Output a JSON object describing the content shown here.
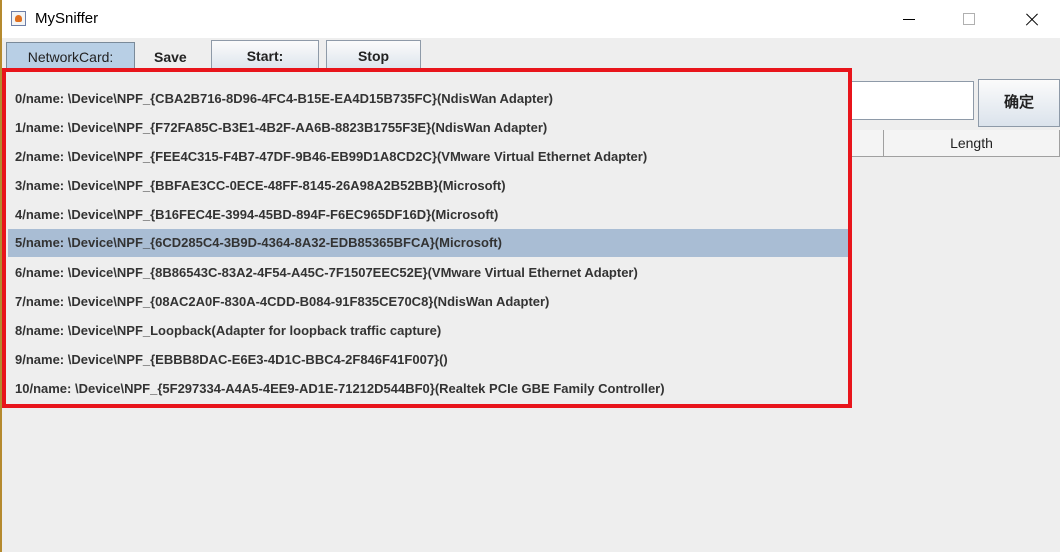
{
  "window": {
    "title": "MySniffer"
  },
  "menubar": {
    "networkcard": "NetworkCard:",
    "save": "Save"
  },
  "toolbar": {
    "start": "Start:",
    "stop": "Stop"
  },
  "filter": {
    "value": "",
    "confirm": "确定"
  },
  "table": {
    "columns": [
      "",
      "Length"
    ]
  },
  "networkcard_menu": {
    "selected_index": 5,
    "items": [
      "0/name: \\Device\\NPF_{CBA2B716-8D96-4FC4-B15E-EA4D15B735FC}(NdisWan Adapter)",
      "1/name: \\Device\\NPF_{F72FA85C-B3E1-4B2F-AA6B-8823B1755F3E}(NdisWan Adapter)",
      "2/name: \\Device\\NPF_{FEE4C315-F4B7-47DF-9B46-EB99D1A8CD2C}(VMware Virtual Ethernet Adapter)",
      "3/name: \\Device\\NPF_{BBFAE3CC-0ECE-48FF-8145-26A98A2B52BB}(Microsoft)",
      "4/name: \\Device\\NPF_{B16FEC4E-3994-45BD-894F-F6EC965DF16D}(Microsoft)",
      "5/name: \\Device\\NPF_{6CD285C4-3B9D-4364-8A32-EDB85365BFCA}(Microsoft)",
      "6/name: \\Device\\NPF_{8B86543C-83A2-4F54-A45C-7F1507EEC52E}(VMware Virtual Ethernet Adapter)",
      "7/name: \\Device\\NPF_{08AC2A0F-830A-4CDD-B084-91F835CE70C8}(NdisWan Adapter)",
      "8/name: \\Device\\NPF_Loopback(Adapter for loopback traffic capture)",
      "9/name: \\Device\\NPF_{EBBB8DAC-E6E3-4D1C-BBC4-2F846F41F007}()",
      "10/name: \\Device\\NPF_{5F297334-A4A5-4EE9-AD1E-71212D544BF0}(Realtek PCIe GBE Family Controller)"
    ]
  },
  "colors": {
    "highlight_border": "#e8141b",
    "selected_row": "#a9bdd4",
    "menu_active": "#b8cfe5"
  }
}
